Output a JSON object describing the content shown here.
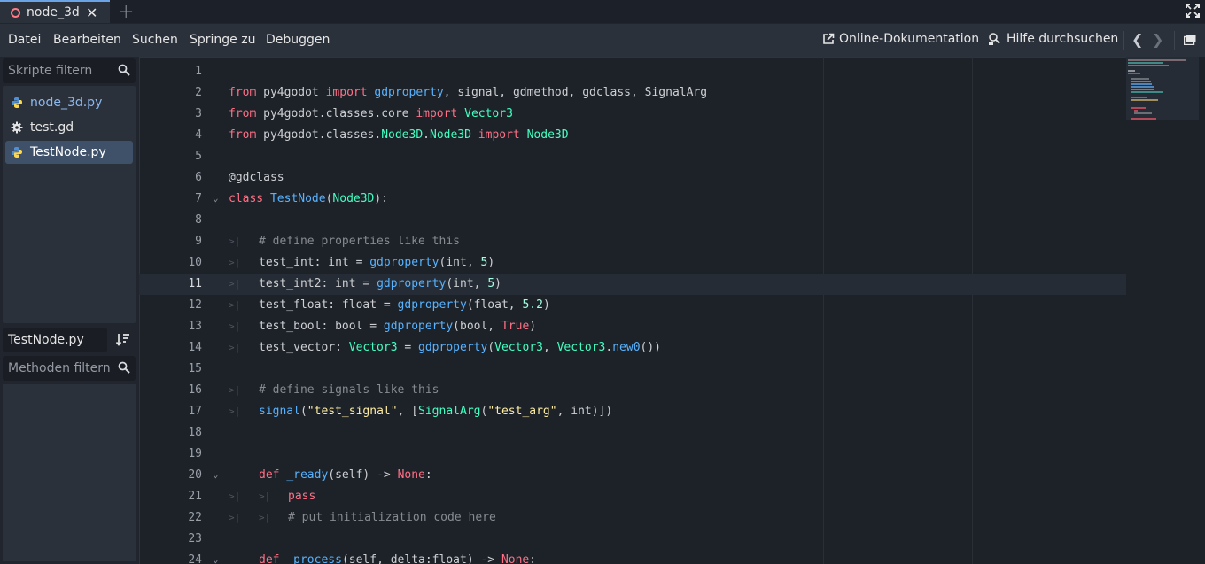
{
  "tabs": [
    {
      "label": "node_3d",
      "close": "✕"
    }
  ],
  "tab_add": "+",
  "menu": {
    "items": [
      "Datei",
      "Bearbeiten",
      "Suchen",
      "Springe zu",
      "Debuggen"
    ],
    "online_doc": "Online-Dokumentation",
    "help_search": "Hilfe durchsuchen",
    "nav_prev": "❮",
    "nav_next": "❯"
  },
  "left": {
    "script_filter_placeholder": "Skripte filtern",
    "scripts": [
      {
        "label": "node_3d.py",
        "icon": "python-icon"
      },
      {
        "label": "test.gd",
        "icon": "gear-icon"
      },
      {
        "label": "TestNode.py",
        "icon": "python-icon",
        "selected": true
      }
    ],
    "current_file": "TestNode.py",
    "method_filter_placeholder": "Methoden filtern"
  },
  "editor": {
    "current_line": 11,
    "line_numbers": [
      "1",
      "2",
      "3",
      "4",
      "5",
      "6",
      "7",
      "8",
      "9",
      "10",
      "11",
      "12",
      "13",
      "14",
      "15",
      "16",
      "17",
      "18",
      "19",
      "20",
      "21",
      "22",
      "23",
      "24"
    ]
  },
  "colors": {
    "keyword": "#ff7085",
    "function": "#57b3ff",
    "class": "#42ffc2",
    "number": "#a1ffe0",
    "string": "#ffeda1",
    "comment": "#878b91",
    "accent": "#6aa3e6"
  }
}
